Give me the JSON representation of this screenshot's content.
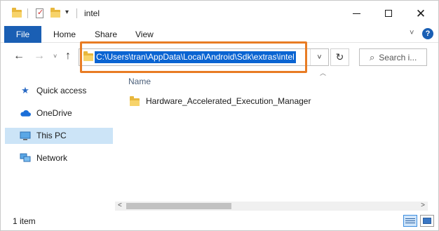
{
  "window": {
    "title": "intel"
  },
  "ribbon": {
    "file_tab": "File",
    "tabs": [
      "Home",
      "Share",
      "View"
    ],
    "help": "?"
  },
  "nav": {
    "back": "←",
    "forward": "→",
    "recent_dropdown": "˅",
    "up": "↑",
    "address_path": "C:\\Users\\tran\\AppData\\Local\\Android\\Sdk\\extras\\intel",
    "address_dropdown": "˅",
    "refresh": "↻",
    "search_placeholder": "Search i..."
  },
  "sidebar": {
    "items": [
      {
        "label": "Quick access",
        "icon": "star-icon",
        "selected": false
      },
      {
        "label": "OneDrive",
        "icon": "cloud-icon",
        "selected": false
      },
      {
        "label": "This PC",
        "icon": "computer-icon",
        "selected": true
      },
      {
        "label": "Network",
        "icon": "network-icon",
        "selected": false
      }
    ]
  },
  "content": {
    "column_header": "Name",
    "files": [
      {
        "name": "Hardware_Accelerated_Execution_Manager",
        "type": "folder"
      }
    ]
  },
  "status": {
    "item_count": "1 item"
  },
  "colors": {
    "accent": "#1a5fb4",
    "selection": "#0a64d2",
    "highlight_box": "#e87c24",
    "sidebar_selected": "#cce4f7",
    "folder": "#f7d36a"
  }
}
